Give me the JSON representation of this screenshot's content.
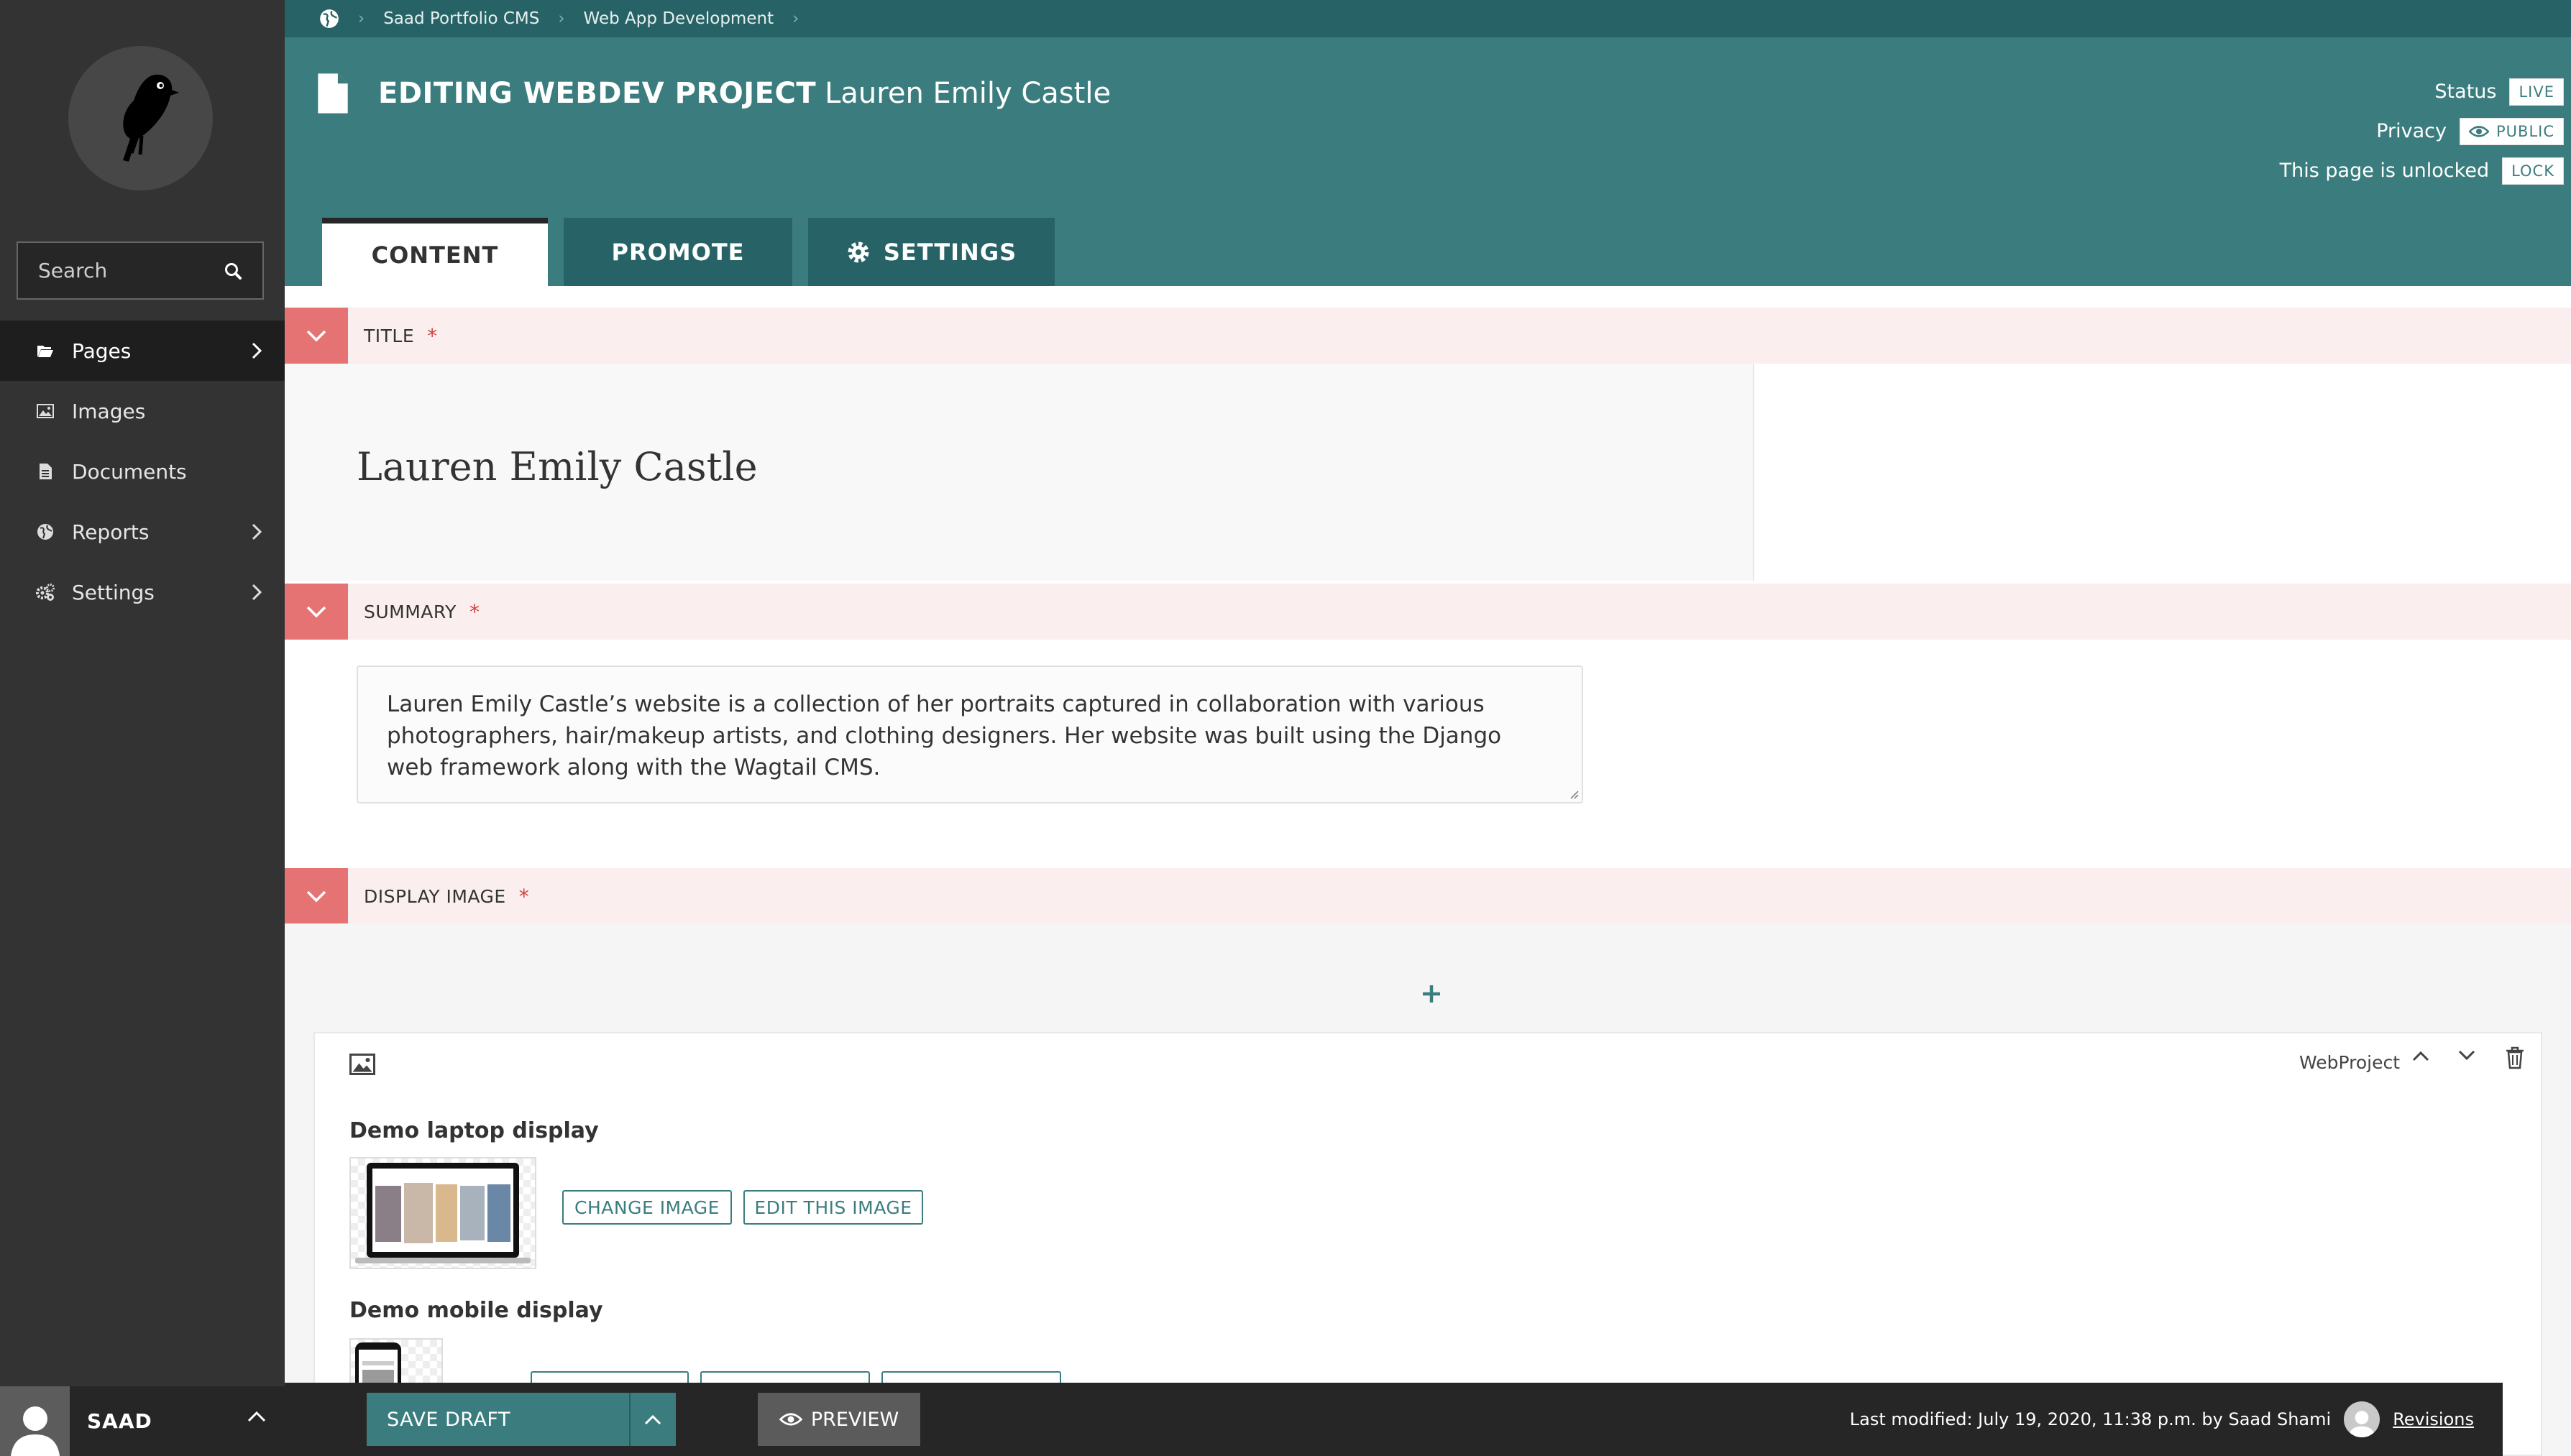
{
  "sidebar": {
    "search_placeholder": "Search",
    "nav": [
      {
        "label": "Pages",
        "icon": "folder-open-icon",
        "has_submenu": true,
        "active": true
      },
      {
        "label": "Images",
        "icon": "image-icon",
        "has_submenu": false
      },
      {
        "label": "Documents",
        "icon": "document-icon",
        "has_submenu": false
      },
      {
        "label": "Reports",
        "icon": "globe-icon",
        "has_submenu": true
      },
      {
        "label": "Settings",
        "icon": "cogs-icon",
        "has_submenu": true
      }
    ],
    "user": {
      "name": "SAAD"
    }
  },
  "header": {
    "breadcrumbs": [
      "Saad Portfolio CMS",
      "Web App Development"
    ],
    "heading_strong": "EDITING WEBDEV PROJECT",
    "heading_title": "Lauren Emily Castle",
    "status_label": "Status",
    "status_value": "LIVE",
    "privacy_label": "Privacy",
    "privacy_value": "PUBLIC",
    "lock_label": "This page is unlocked",
    "lock_button": "LOCK",
    "tabs": [
      "CONTENT",
      "PROMOTE",
      "SETTINGS"
    ],
    "accent": "#3b7d7e"
  },
  "form": {
    "title": {
      "label": "TITLE",
      "value": "Lauren Emily Castle"
    },
    "summary": {
      "label": "SUMMARY",
      "value": "Lauren Emily Castle’s website is a collection of her portraits captured in collaboration with various photographers, hair/makeup artists, and clothing designers. Her website was built using the Django web framework along with the Wagtail CMS."
    },
    "display_image": {
      "label": "DISPLAY IMAGE",
      "block_type": "WebProject",
      "laptop": {
        "label": "Demo laptop display",
        "change_button": "CHANGE IMAGE",
        "edit_button": "EDIT THIS IMAGE"
      },
      "mobile": {
        "label": "Demo mobile display"
      }
    },
    "required_marker": "*"
  },
  "footer": {
    "save_label": "SAVE DRAFT",
    "preview_label": "PREVIEW",
    "last_modified": "Last modified: July 19, 2020, 11:38 p.m. by Saad Shami",
    "revisions_label": "Revisions"
  }
}
